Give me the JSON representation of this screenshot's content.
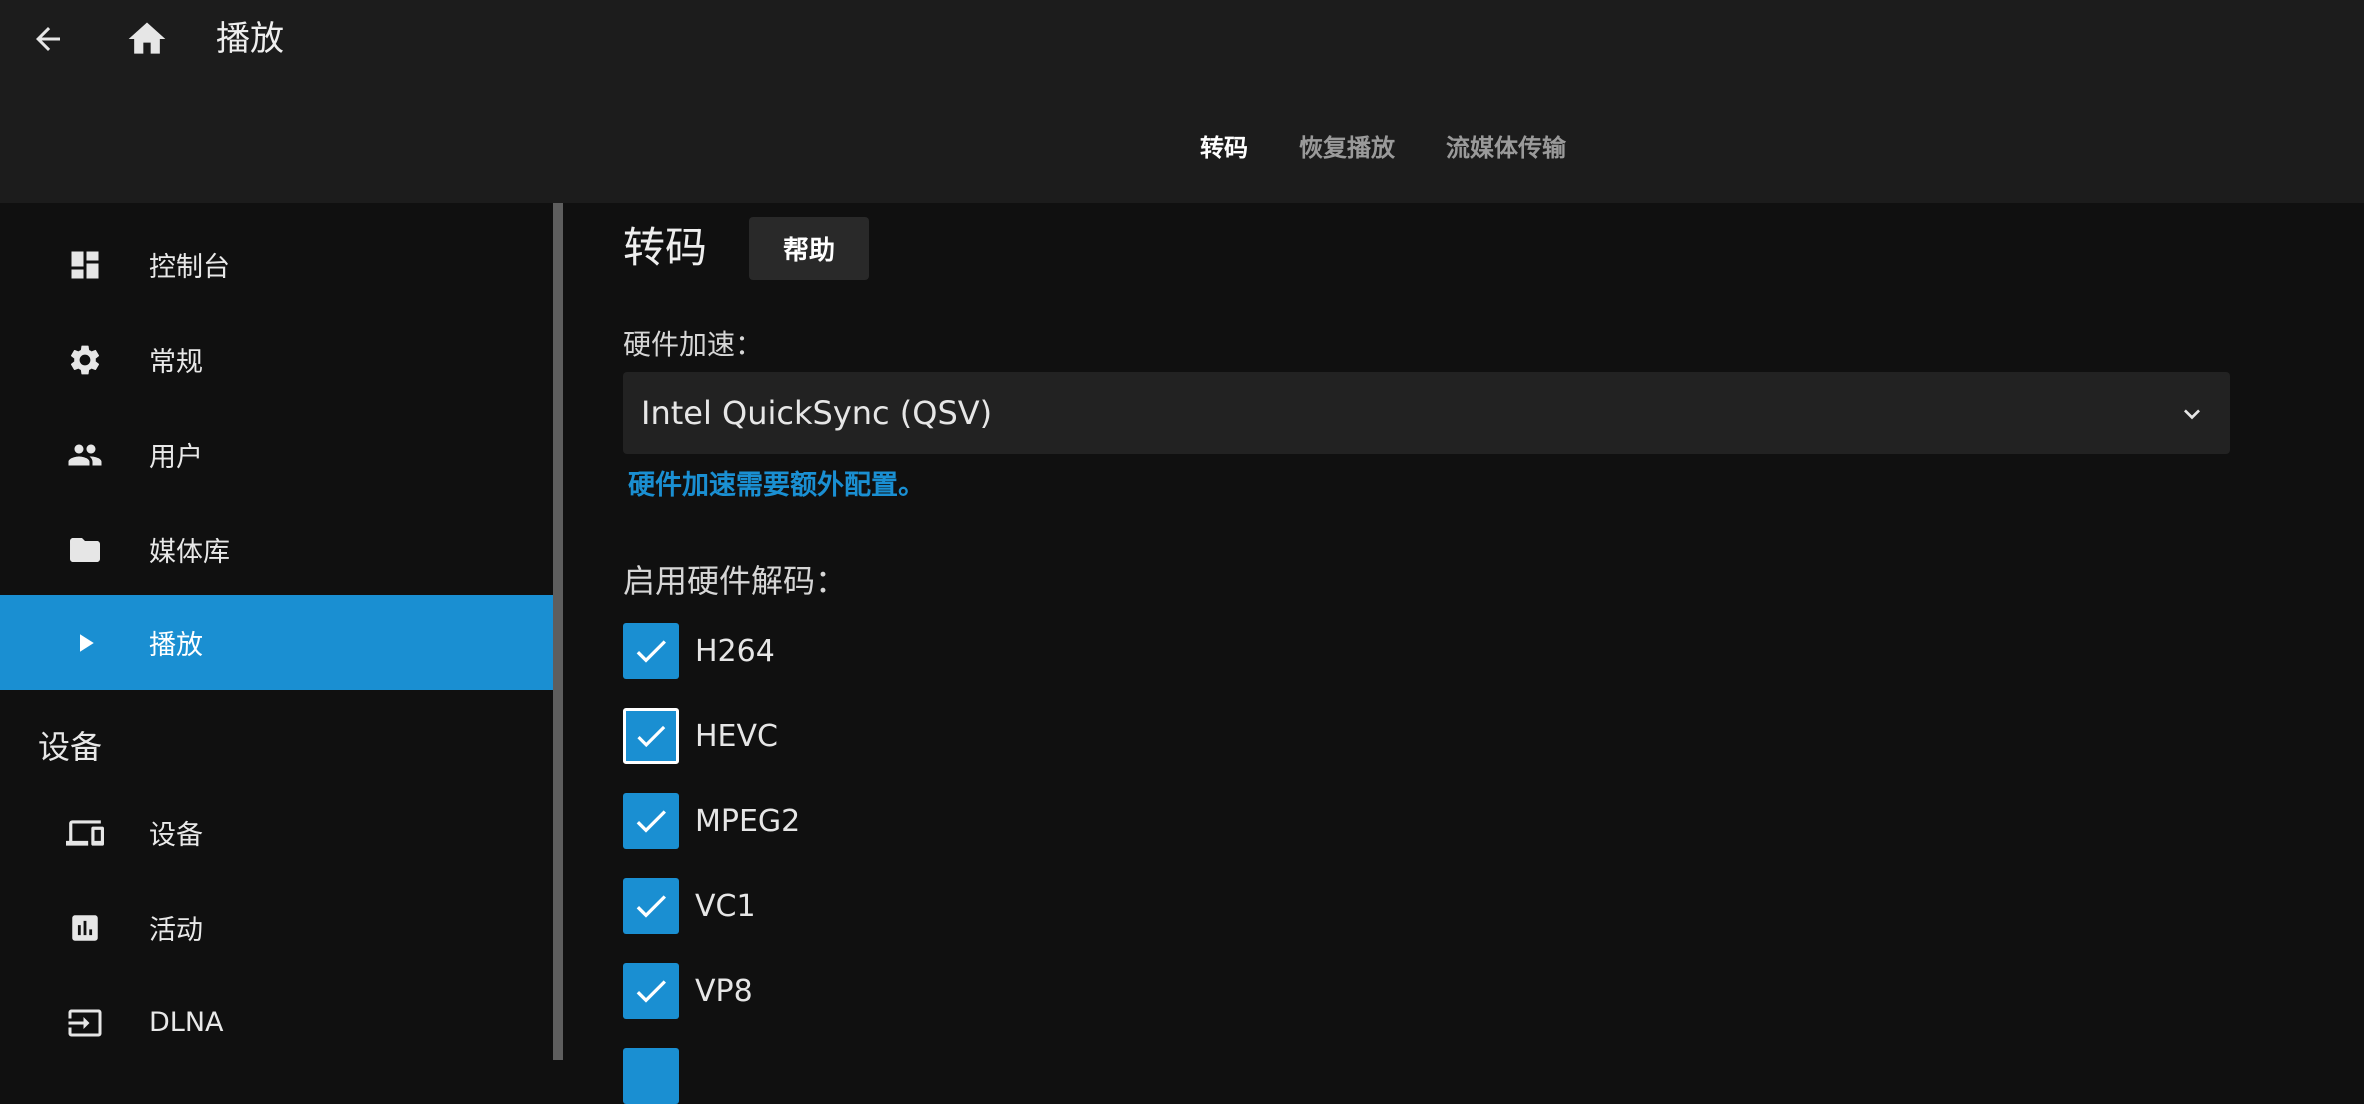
{
  "header": {
    "title": "播放",
    "tabs": [
      {
        "label": "转码",
        "active": true
      },
      {
        "label": "恢复播放",
        "active": false
      },
      {
        "label": "流媒体传输",
        "active": false
      }
    ]
  },
  "sidebar": {
    "items": [
      {
        "label": "控制台",
        "icon": "dashboard-icon"
      },
      {
        "label": "常规",
        "icon": "gear-icon"
      },
      {
        "label": "用户",
        "icon": "people-icon"
      },
      {
        "label": "媒体库",
        "icon": "folder-icon"
      },
      {
        "label": "播放",
        "icon": "play-icon",
        "selected": true
      }
    ],
    "section_title": "设备",
    "section_items": [
      {
        "label": "设备",
        "icon": "devices-icon"
      },
      {
        "label": "活动",
        "icon": "activity-chart-icon"
      },
      {
        "label": "DLNA",
        "icon": "input-icon"
      }
    ]
  },
  "main": {
    "title": "转码",
    "help_label": "帮助",
    "hw_accel_label": "硬件加速：",
    "hw_accel_value": "Intel QuickSync (QSV)",
    "hw_accel_note": "硬件加速需要额外配置。",
    "decode_label": "启用硬件解码：",
    "decoders": [
      {
        "label": "H264",
        "checked": true
      },
      {
        "label": "HEVC",
        "checked": true,
        "focused": true
      },
      {
        "label": "MPEG2",
        "checked": true
      },
      {
        "label": "VC1",
        "checked": true
      },
      {
        "label": "VP8",
        "checked": true
      }
    ]
  },
  "colors": {
    "accent": "#1a8fd2",
    "header_bg": "#1c1c1c",
    "page_bg": "#101010"
  }
}
